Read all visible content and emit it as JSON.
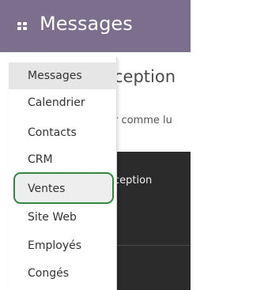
{
  "navbar": {
    "title": "Messages",
    "apps_icon": "apps-grid-icon"
  },
  "background": {
    "heading_fragment": "ception",
    "subtext_fragment": "r comme lu",
    "dark_row_fragment": "ception"
  },
  "menu": {
    "items": [
      {
        "label": "Messages"
      },
      {
        "label": "Calendrier"
      },
      {
        "label": "Contacts"
      },
      {
        "label": "CRM"
      },
      {
        "label": "Ventes"
      },
      {
        "label": "Site Web"
      },
      {
        "label": "Employés"
      },
      {
        "label": "Congés"
      }
    ],
    "active_item": "Messages",
    "highlighted_item": "Ventes"
  },
  "colors": {
    "navbar": "#7c6f8e",
    "highlight_ring": "#2e8b3a",
    "active_bg": "#e6e6e6",
    "dark_panel": "#2b2b2b"
  }
}
